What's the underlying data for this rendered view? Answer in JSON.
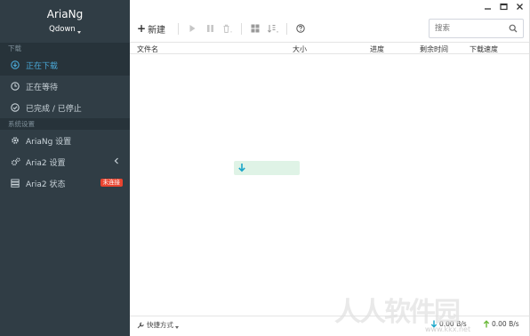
{
  "app": {
    "name": "AriaNg",
    "server": "Qdown"
  },
  "sidebar": {
    "sections": [
      {
        "title": "下载"
      },
      {
        "title": "系统设置"
      }
    ],
    "items": [
      {
        "label": "正在下载",
        "icon": "download-circle-icon"
      },
      {
        "label": "正在等待",
        "icon": "clock-icon"
      },
      {
        "label": "已完成 / 已停止",
        "icon": "check-circle-icon"
      },
      {
        "label": "AriaNg 设置",
        "icon": "gear-icon"
      },
      {
        "label": "Aria2 设置",
        "icon": "gears-icon"
      },
      {
        "label": "Aria2 状态",
        "icon": "server-icon",
        "badge": "未连接"
      }
    ]
  },
  "toolbar": {
    "new_label": "新建"
  },
  "search": {
    "placeholder": "搜索",
    "value": ""
  },
  "table": {
    "columns": [
      "文件名",
      "大小",
      "进度",
      "剩余时间",
      "下载速度"
    ]
  },
  "footer": {
    "shortcut_label": "快捷方式",
    "download_speed": "0.00 B/s",
    "upload_speed": "0.00 B/s"
  },
  "watermark": {
    "text": "人人软件园",
    "url": "www.kkx.net"
  },
  "colors": {
    "sidebar_bg": "#303d45",
    "active_text": "#4aa9d8",
    "badge": "#e8442f",
    "empty_box": "#dff3e6",
    "download_arrow": "#1aa6c9",
    "upload_arrow": "#6bb93a"
  }
}
